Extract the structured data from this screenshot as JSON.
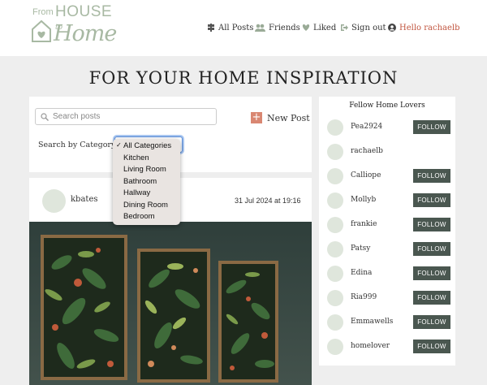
{
  "brand": {
    "from": "From",
    "house": "HOUSE",
    "to": "to",
    "home": "Home"
  },
  "nav": {
    "all_posts": "All Posts",
    "friends": "Friends",
    "liked": "Liked",
    "sign_out": "Sign out",
    "hello": "Hello rachaelb"
  },
  "colors": {
    "accent": "#c1553f",
    "sage": "#a8b9a3",
    "follow_button": "#4a5750",
    "plus_button": "#d98772"
  },
  "page_title": "FOR YOUR HOME INSPIRATION",
  "search": {
    "placeholder": "Search posts"
  },
  "new_post_label": "New Post",
  "category": {
    "label": "Search by Category:",
    "selected": "All Categories",
    "options": [
      "All Categories",
      "Kitchen",
      "Living Room",
      "Bathroom",
      "Hallway",
      "Dining Room",
      "Bedroom"
    ]
  },
  "post": {
    "author": "kbates",
    "date": "31 Jul 2024 at 19:16"
  },
  "sidebar": {
    "title": "Fellow Home Lovers",
    "users": [
      {
        "name": "Pea2924",
        "action": "FOLLOW"
      },
      {
        "name": "rachaelb",
        "action": ""
      },
      {
        "name": "Calliope",
        "action": "FOLLOW"
      },
      {
        "name": "Mollyb",
        "action": "FOLLOW"
      },
      {
        "name": "frankie",
        "action": "FOLLOW"
      },
      {
        "name": "Patsy",
        "action": "FOLLOW"
      },
      {
        "name": "Edina",
        "action": "FOLLOW"
      },
      {
        "name": "Ria999",
        "action": "FOLLOW"
      },
      {
        "name": "Emmawells",
        "action": "FOLLOW"
      },
      {
        "name": "homelover",
        "action": "FOLLOW"
      }
    ]
  }
}
